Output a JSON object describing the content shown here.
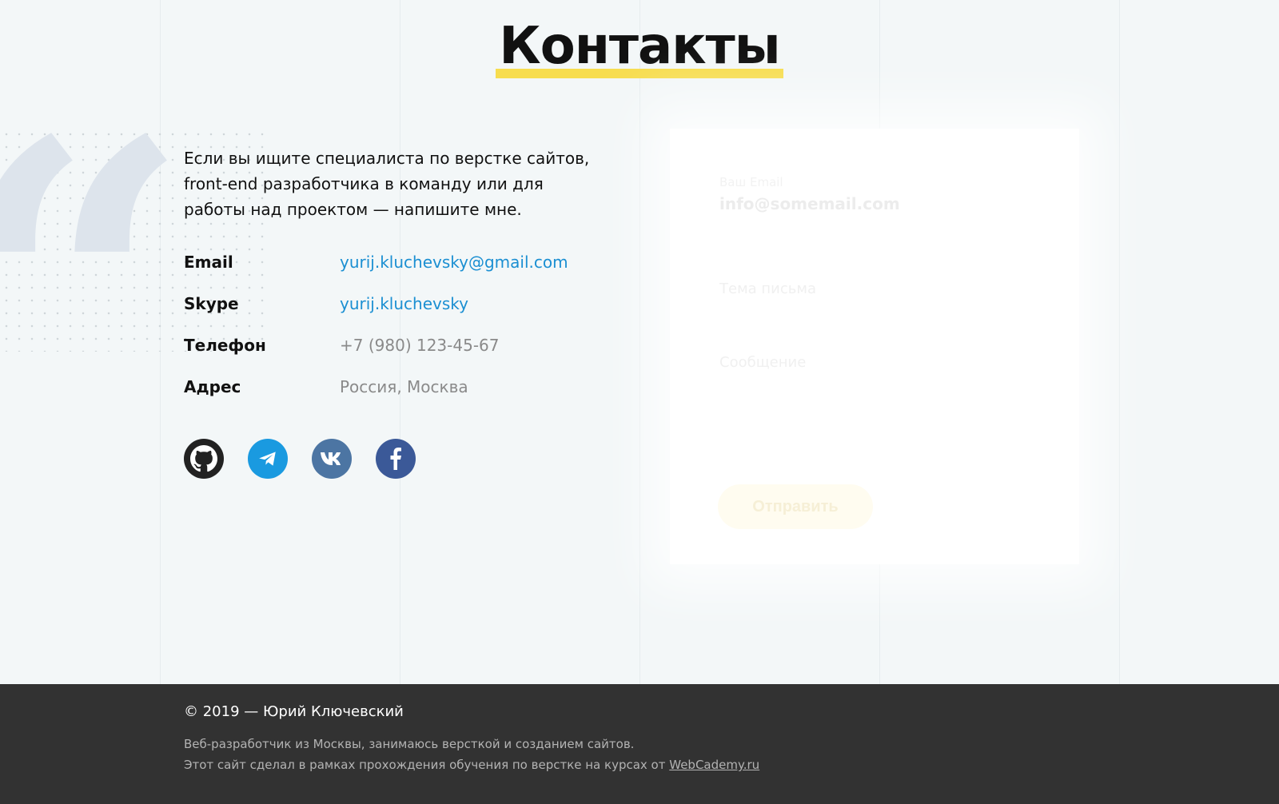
{
  "header": {
    "title": "Контакты"
  },
  "intro": {
    "text": "Если вы ищите специалиста по верстке сайтов, front-end разработчика в команду или для работы над проектом —  напишите мне."
  },
  "contacts": [
    {
      "label": "Email",
      "value": "yurij.kluchevsky@gmail.com"
    },
    {
      "label": "Skype",
      "value": "yurij.kluchevsky"
    },
    {
      "label": "Телефон",
      "value": "+7 (980) 123-45-67"
    },
    {
      "label": "Адрес",
      "value": "Россия, Москва"
    }
  ],
  "socials": [
    {
      "icon": "github-icon",
      "color": "#222222"
    },
    {
      "icon": "telegram-icon",
      "color": "#1a9ae0"
    },
    {
      "icon": "vk-icon",
      "color": "#4c75a3"
    },
    {
      "icon": "facebook-icon",
      "color": "#3b5998"
    }
  ],
  "form": {
    "email_label": "Ваш Email",
    "email_value": "info@somemail.com",
    "name_placeholder": "Тема письма",
    "message_placeholder": "Сообщение",
    "submit_label": "Отправить"
  },
  "footer": {
    "copyright": "© 2019 — Юрий Ключевский",
    "line1": "Веб-разработчик из Москвы, занимаюсь версткой и созданием сайтов.",
    "line2_prefix": "Этот сайт сделал в рамках прохождения обучения по верстке на курсах от ",
    "line2_link": "WebCademy.ru"
  },
  "colors": {
    "accent_yellow": "#f7dd4f",
    "link_blue": "#1b8fd2",
    "footer_bg": "#323232",
    "page_bg": "#f3f7f8"
  }
}
